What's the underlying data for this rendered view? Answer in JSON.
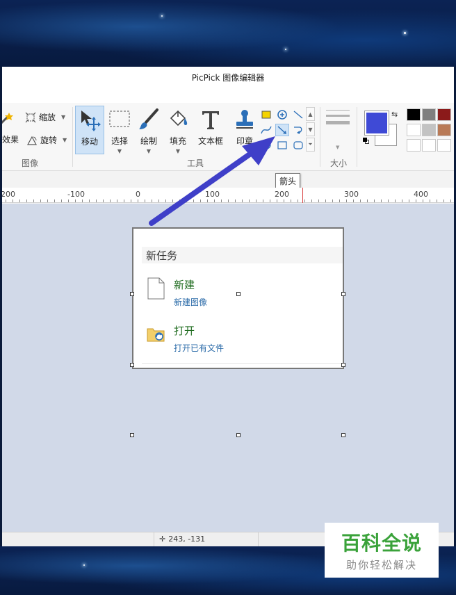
{
  "window": {
    "title": "PicPick 图像编辑器"
  },
  "ribbon": {
    "image_group": {
      "label": "图像",
      "effects_label": "效果",
      "resize_label": "缩放",
      "rotate_label": "旋转"
    },
    "tools_group": {
      "label": "工具",
      "move_label": "移动",
      "select_label": "选择",
      "draw_label": "绘制",
      "fill_label": "填充",
      "textbox_label": "文本框",
      "stamp_label": "印章"
    },
    "size_group": {
      "label": "大小"
    },
    "colors": {
      "primary": "#3f4ad6",
      "secondary": "#ffffff",
      "palette": [
        "#000000",
        "#7f7f7f",
        "#8b1a1a",
        "#ffffff",
        "#c3c3c3",
        "#b97a57",
        "#ffffff",
        "#ffffff",
        "#ffffff"
      ]
    }
  },
  "tooltip": {
    "text": "箭头"
  },
  "ruler": {
    "labels": [
      "200",
      "-100",
      "0",
      "100",
      "200",
      "300",
      "400"
    ]
  },
  "canvas_image": {
    "header": "新任务",
    "items": [
      {
        "title": "新建",
        "subtitle": "新建图像"
      },
      {
        "title": "打开",
        "subtitle": "打开已有文件"
      }
    ]
  },
  "statusbar": {
    "coords": "243, -131"
  },
  "watermark": {
    "main": "百科全说",
    "sub": "助你轻松解决"
  }
}
